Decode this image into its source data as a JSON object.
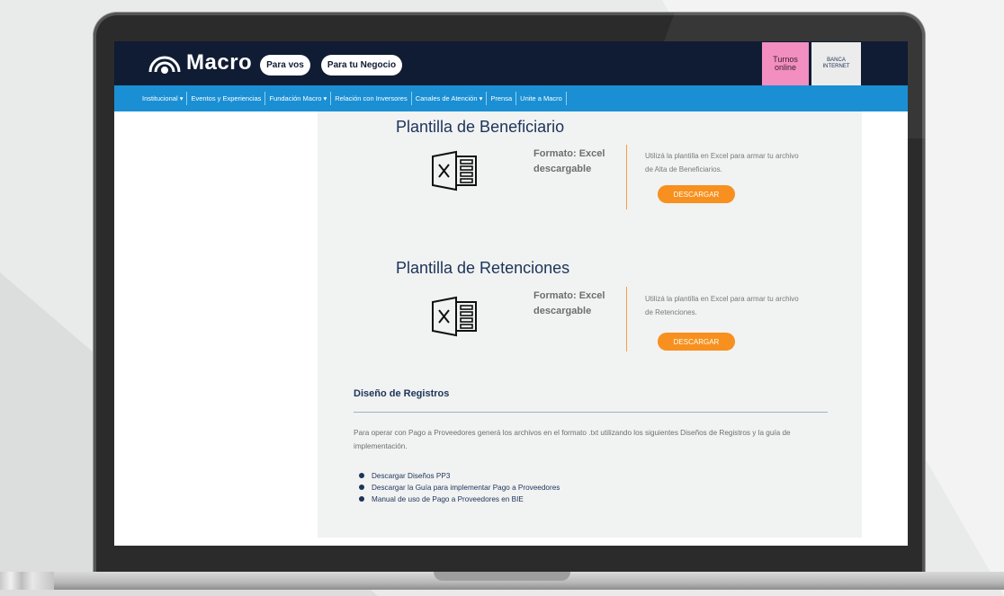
{
  "header": {
    "brand": "Macro",
    "pill_vos": "Para vos",
    "pill_negocio": "Para tu Negocio",
    "turnos_line1": "Turnos",
    "turnos_line2": "online",
    "banca_line1": "BANCA",
    "banca_line2": "INTERNET"
  },
  "nav": {
    "items": [
      {
        "label": "Institucional",
        "caret": "▾"
      },
      {
        "label": "Eventos y Experiencias",
        "caret": ""
      },
      {
        "label": "Fundación Macro",
        "caret": "▾"
      },
      {
        "label": "Relación con Inversores",
        "caret": ""
      },
      {
        "label": "Canales de Atención",
        "caret": "▾"
      },
      {
        "label": "Prensa",
        "caret": ""
      },
      {
        "label": "Unite a Macro",
        "caret": ""
      }
    ]
  },
  "sections": [
    {
      "title": "Plantilla de Beneficiario",
      "format_line1": "Formato: Excel",
      "format_line2": "descargable",
      "description": "Utilizá la plantilla en Excel para armar tu archivo de Alta de Beneficiarios.",
      "button": "DESCARGAR",
      "icon": "excel-file-icon"
    },
    {
      "title": "Plantilla de Retenciones",
      "format_line1": "Formato: Excel",
      "format_line2": "descargable",
      "description": "Utilizá la plantilla en Excel para armar tu archivo de Retenciones.",
      "button": "DESCARGAR",
      "icon": "excel-file-icon"
    }
  ],
  "registros": {
    "title": "Diseño de Registros",
    "text": "Para operar con Pago a Proveedores generá los archivos en el formato .txt utilizando los siguientes Diseños de Registros y la guía de implementación.",
    "links": [
      "Descargar Diseños PP3",
      "Descargar la Guía para implementar Pago a Proveedores",
      "Manual de uso de Pago a Proveedores en BIE"
    ]
  },
  "colors": {
    "header_bg": "#101c33",
    "nav_bg": "#1a8fd3",
    "accent_orange": "#f7901e",
    "turnos_pink": "#f28ec0",
    "title_blue": "#1c3459"
  }
}
